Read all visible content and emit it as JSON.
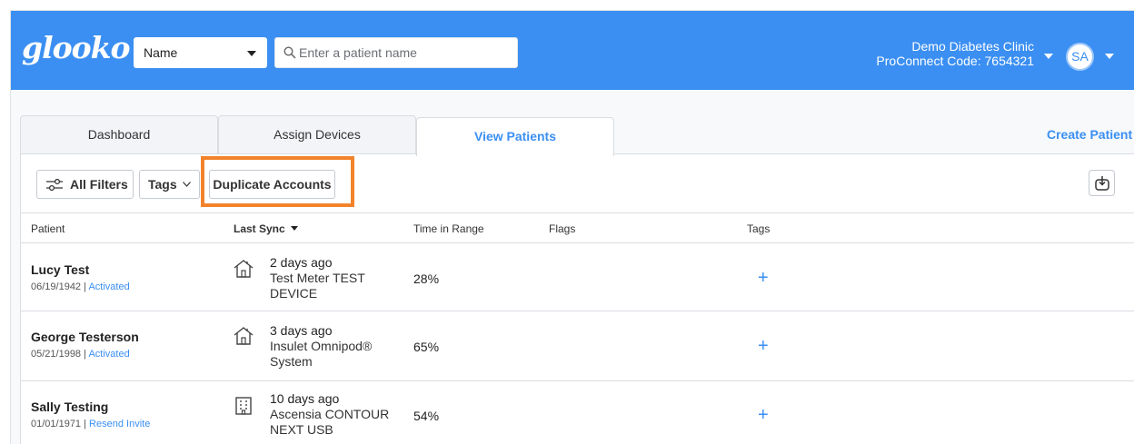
{
  "app": {
    "logo": "glooko"
  },
  "search": {
    "field_type": "Name",
    "placeholder": "Enter a patient name",
    "value": ""
  },
  "clinic": {
    "name": "Demo Diabetes Clinic",
    "proconnect": "ProConnect Code: 7654321"
  },
  "user": {
    "initials": "SA"
  },
  "tabs": [
    {
      "label": "Dashboard"
    },
    {
      "label": "Assign Devices"
    },
    {
      "label": "View Patients"
    }
  ],
  "active_tab": "View Patients",
  "create_patient": "Create Patient",
  "toolbar": {
    "filters_label": "All Filters",
    "tags_label": "Tags",
    "duplicate_label": "Duplicate Accounts"
  },
  "columns": {
    "patient": "Patient",
    "last_sync": "Last Sync",
    "time_in_range": "Time in Range",
    "flags": "Flags",
    "tags": "Tags"
  },
  "rows": [
    {
      "name": "Lucy Test",
      "dob": "06/19/1942",
      "status": "Activated",
      "sync_ago": "2 days ago",
      "device": "Test Meter TEST DEVICE",
      "device_icon": "home-icon",
      "tir": "28%",
      "add_tag": "+"
    },
    {
      "name": "George Testerson",
      "dob": "05/21/1998",
      "status": "Activated",
      "sync_ago": "3 days ago",
      "device": "Insulet Omnipod® System",
      "device_icon": "home-icon",
      "tir": "65%",
      "add_tag": "+"
    },
    {
      "name": "Sally Testing",
      "dob": "01/01/1971",
      "status": "Resend Invite",
      "sync_ago": "10 days ago",
      "device": "Ascensia CONTOUR NEXT USB",
      "device_icon": "clinic-building-icon",
      "tir": "54%",
      "add_tag": "+"
    }
  ],
  "colors": {
    "brand": "#3b8ff2",
    "highlight": "#f2832b"
  }
}
